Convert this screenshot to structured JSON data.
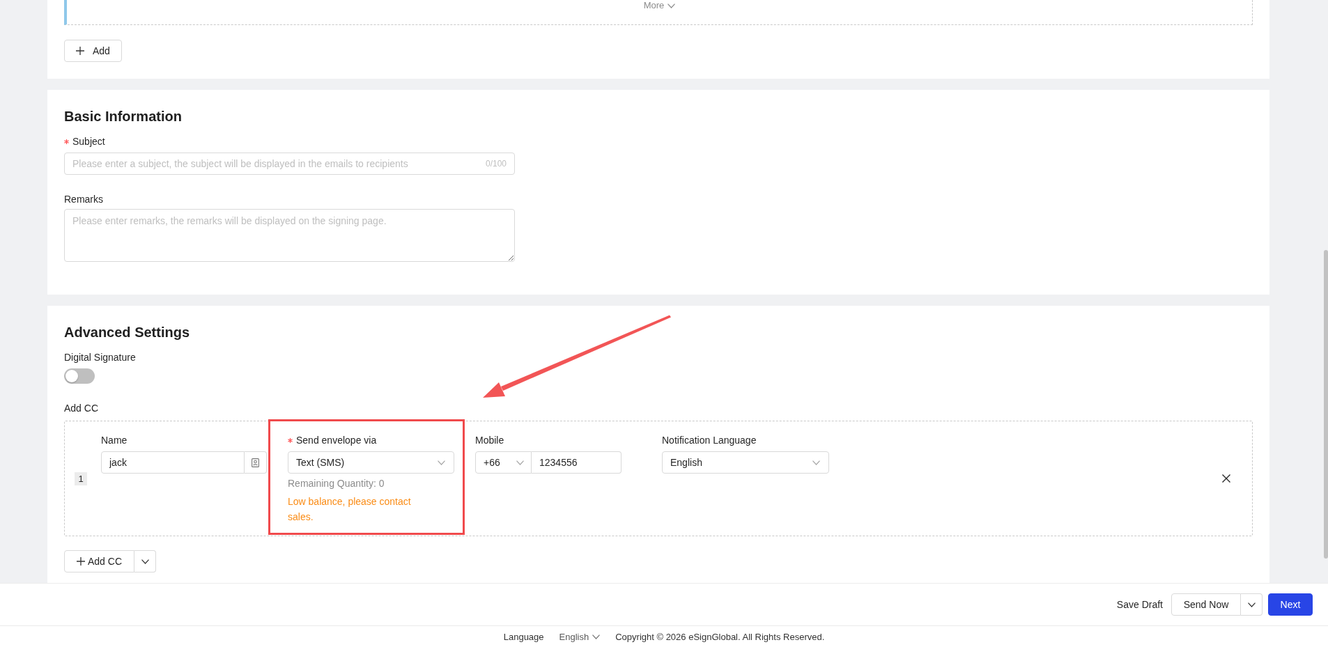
{
  "recipients": {
    "more_button": "More",
    "add_button": "Add"
  },
  "basic_information": {
    "title": "Basic Information",
    "fields": [
      {
        "kind": "input",
        "label": "Subject",
        "required": true,
        "placeholder": "Please enter a subject, the subject will be displayed in the emails to recipients",
        "counter": "0/100"
      },
      {
        "kind": "textarea",
        "label": "Remarks",
        "required": false,
        "placeholder": "Please enter remarks, the remarks will be displayed on the signing page."
      }
    ]
  },
  "advanced_settings": {
    "title": "Advanced Settings",
    "digital_signature": {
      "label": "Digital Signature",
      "on": false
    },
    "add_cc": {
      "label": "Add CC",
      "rows": [
        {
          "number": "1",
          "name": {
            "label": "Name",
            "required": false,
            "value": "jack"
          },
          "send_via": {
            "label": "Send envelope via",
            "required": true,
            "value": "Text (SMS)",
            "remaining": "Remaining Quantity: 0",
            "warning": "Low balance, please contact sales."
          },
          "mobile": {
            "label": "Mobile",
            "required": false,
            "country_code": "+66",
            "value": "1234556"
          },
          "notification_language": {
            "label": "Notification Language",
            "required": false,
            "value": "English"
          }
        }
      ],
      "add_button": "Add CC"
    }
  },
  "actions": {
    "save_draft": "Save Draft",
    "send_now": "Send Now",
    "next": "Next"
  },
  "footer": {
    "language_label": "Language",
    "language": "English",
    "copyright": "Copyright © 2026 eSignGlobal. All Rights Reserved."
  },
  "annotation": {
    "kind": "highlight_with_arrow"
  }
}
